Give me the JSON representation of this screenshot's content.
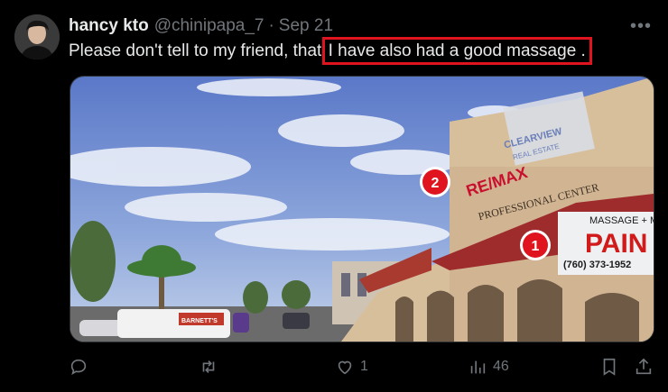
{
  "tweet": {
    "display_name": "hancy kto",
    "handle": "@chinipapa_7",
    "separator": "·",
    "date": "Sep 21",
    "text_before": "Please don't tell to my friend, that ",
    "text_highlight": "I have also had a good massage .",
    "more_label": "•••"
  },
  "media": {
    "building_sign_top": "CLEARVIEW",
    "building_sign_sub": "REAL ESTATE",
    "sign_brand": "RE/MAX",
    "sign_line": "PROFESSIONAL CENTER",
    "massage_sign": "MASSAGE + M",
    "pain_sign": "PAIN",
    "phone": "(760) 373-1952",
    "van_text": "BARNETT'S",
    "marker_1": "1",
    "marker_2": "2"
  },
  "actions": {
    "reply_count": "",
    "retweet_count": "",
    "like_count": "1",
    "views_count": "46"
  },
  "icons": [
    "reply-icon",
    "retweet-icon",
    "like-icon",
    "views-icon",
    "bookmark-icon",
    "share-icon",
    "more-icon"
  ],
  "colors": {
    "highlight": "#e0141e",
    "muted": "#71767b",
    "marker": "#e0141e"
  }
}
